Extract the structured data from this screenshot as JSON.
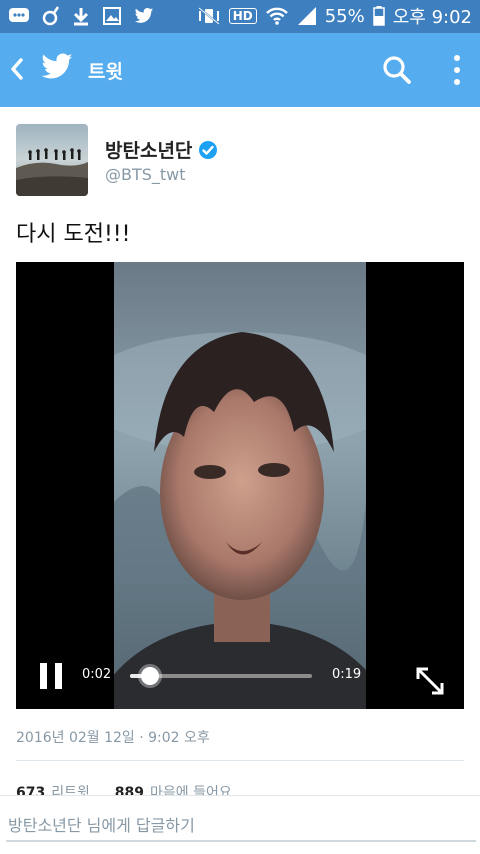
{
  "status_bar": {
    "battery": "55%",
    "time": "오후 9:02",
    "hd_label": "HD"
  },
  "app_bar": {
    "title": "트윗"
  },
  "tweet": {
    "display_name": "방탄소년단",
    "handle": "@BTS_twt",
    "text": "다시 도전!!!",
    "video": {
      "current_time": "0:02",
      "total_time": "0:19",
      "progress": 0.11
    },
    "timestamp": "2016년 02월 12일 · 9:02 오후",
    "stats": {
      "retweets_count": "673",
      "retweets_label": "리트윗",
      "likes_count": "889",
      "likes_label": "마음에 들어요"
    }
  },
  "reply": {
    "placeholder": "방탄소년단 님에게 답글하기"
  },
  "colors": {
    "status_bar": "#3d7fbf",
    "app_bar": "#55acee",
    "verified": "#1da1f2",
    "muted_text": "#8899a6"
  }
}
